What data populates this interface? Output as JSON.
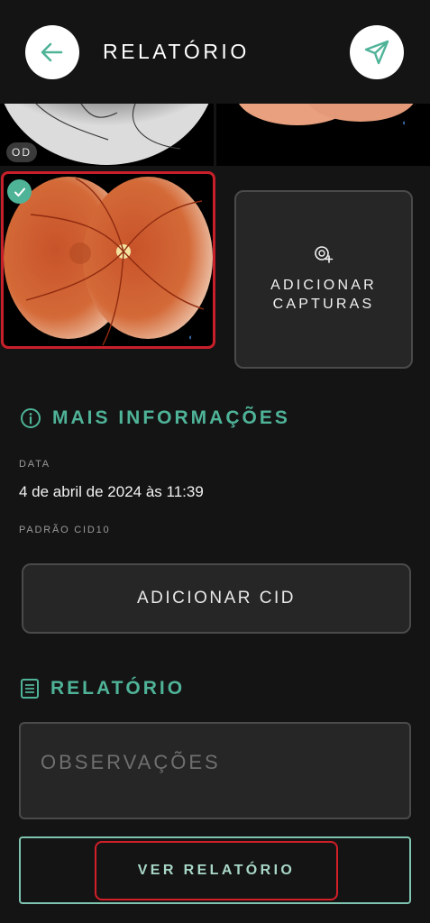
{
  "header": {
    "title": "RELATÓRIO",
    "back_icon": "arrow-left-icon",
    "send_icon": "send-icon"
  },
  "images": {
    "top_left_label": "OD",
    "selected_icon": "check-icon"
  },
  "add_captures": {
    "icon": "eye-add-icon",
    "label": "ADICIONAR CAPTURAS"
  },
  "info_section": {
    "icon": "info-icon",
    "title": "MAIS INFORMAÇÕES",
    "date_label": "DATA",
    "date_value": "4 de abril de 2024 às 11:39",
    "cid_label": "PADRÃO CID10",
    "add_cid_label": "ADICIONAR CID"
  },
  "report_section": {
    "icon": "document-icon",
    "title": "RELATÓRIO",
    "observations_placeholder": "OBSERVAÇÕES",
    "view_report_label": "VER RELATÓRIO"
  },
  "colors": {
    "background": "#141414",
    "accent": "#4fb398",
    "highlight": "#d21f28",
    "card": "#262626"
  }
}
